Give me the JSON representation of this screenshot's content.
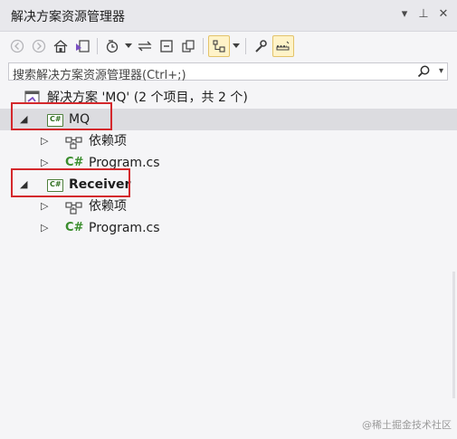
{
  "titlebar": {
    "title": "解决方案资源管理器",
    "dropdown_glyph": "▾",
    "pin_glyph": "⊥",
    "close_glyph": "✕"
  },
  "toolbar": {
    "icons": [
      "back-icon",
      "forward-icon",
      "home-icon",
      "switch-views-icon",
      "pending-changes-icon",
      "dropdown-icon",
      "sync-icon",
      "collapse-all-icon",
      "show-all-files-icon",
      "preview-selected-icon",
      "properties-icon",
      "preview-icon"
    ]
  },
  "search": {
    "placeholder": "搜索解决方案资源管理器(Ctrl+;)"
  },
  "tree": {
    "solution": {
      "label": "解决方案 'MQ' (2 个项目，共 2 个)"
    },
    "projects": [
      {
        "name": "MQ",
        "children": [
          {
            "label": "依赖项",
            "icon": "dependencies-icon"
          },
          {
            "label": "Program.cs",
            "icon": "csharp-file-icon"
          }
        ]
      },
      {
        "name": "Receiver",
        "children": [
          {
            "label": "依赖项",
            "icon": "dependencies-icon"
          },
          {
            "label": "Program.cs",
            "icon": "csharp-file-icon"
          }
        ]
      }
    ]
  },
  "watermark": "@稀土掘金技术社区",
  "colors": {
    "annotation_box": "#d4282c",
    "selection": "#dcdce0",
    "csharp": "#3a8d2d"
  }
}
